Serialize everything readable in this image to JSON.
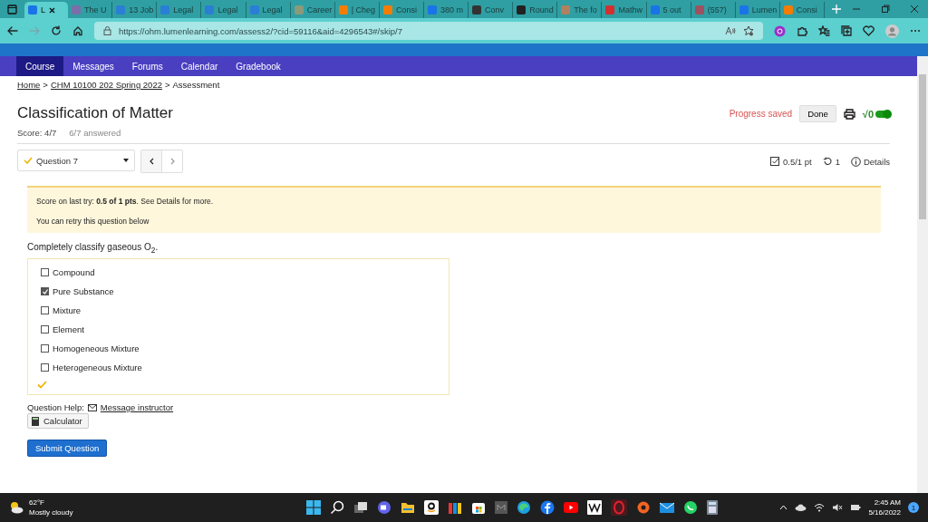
{
  "browser": {
    "tabs": [
      {
        "title": "L",
        "color": "#1a73e8",
        "selected": true
      },
      {
        "title": "The U",
        "color": "#7a6fa8",
        "selected": false
      },
      {
        "title": "13 Job",
        "color": "#2a7fd4",
        "selected": false
      },
      {
        "title": "Legal",
        "color": "#2a7fd4",
        "selected": false
      },
      {
        "title": "Legal",
        "color": "#2a7fd4",
        "selected": false
      },
      {
        "title": "Legal",
        "color": "#2a7fd4",
        "selected": false
      },
      {
        "title": "Career",
        "color": "#8a9a7a",
        "selected": false
      },
      {
        "title": "| Cheg",
        "color": "#f57c00",
        "selected": false
      },
      {
        "title": "Consi",
        "color": "#f57c00",
        "selected": false
      },
      {
        "title": "380 m",
        "color": "#1a73e8",
        "selected": false
      },
      {
        "title": "Conv",
        "color": "#333333",
        "selected": false
      },
      {
        "title": "Round",
        "color": "#222222",
        "selected": false
      },
      {
        "title": "The fo",
        "color": "#b08060",
        "selected": false
      },
      {
        "title": "Mathw",
        "color": "#d32f2f",
        "selected": false
      },
      {
        "title": "5 out",
        "color": "#1a73e8",
        "selected": false
      },
      {
        "title": "(557)",
        "color": "#a05060",
        "selected": false
      },
      {
        "title": "Lumen",
        "color": "#1a73e8",
        "selected": false
      },
      {
        "title": "Consi",
        "color": "#f57c00",
        "selected": false
      }
    ],
    "address": "https://ohm.lumenlearning.com/assess2/?cid=59116&aid=4296543#/skip/7"
  },
  "nav": [
    {
      "label": "Course",
      "selected": true
    },
    {
      "label": "Messages",
      "selected": false
    },
    {
      "label": "Forums",
      "selected": false
    },
    {
      "label": "Calendar",
      "selected": false
    },
    {
      "label": "Gradebook",
      "selected": false
    }
  ],
  "breadcrumb": {
    "separator": ">",
    "items": [
      {
        "label": "Home",
        "link": true
      },
      {
        "label": "CHM 10100 202 Spring 2022",
        "link": true
      },
      {
        "label": "Assessment",
        "link": false
      }
    ]
  },
  "assessment": {
    "title": "Classification of Matter",
    "score": "Score: 4/7",
    "answered": "6/7 answered",
    "progress": "Progress saved",
    "done": "Done",
    "math_toggle": {
      "label": "√0",
      "on": true
    },
    "question_select": "Question 7",
    "points": "0.5/1 pt",
    "retries": "1",
    "details": "Details"
  },
  "alert": {
    "lines": [
      "Score on last try: **0.5 of 1 pts**. See Details for more.",
      "You can retry this question below"
    ]
  },
  "question": {
    "prompt": "Completely classify gaseous O$_{2}$.",
    "choices": [
      {
        "label": "Compound",
        "checked": false
      },
      {
        "label": "Pure Substance",
        "checked": true
      },
      {
        "label": "Mixture",
        "checked": false
      },
      {
        "label": "Element",
        "checked": false
      },
      {
        "label": "Homogeneous Mixture",
        "checked": false
      },
      {
        "label": "Heterogeneous Mixture",
        "checked": false
      }
    ]
  },
  "help": {
    "label": "Question Help:",
    "message": "Message instructor",
    "calculator": "Calculator"
  },
  "submit": "Submit Question",
  "taskbar": {
    "temp": "62°F",
    "weather": "Mostly cloudy",
    "time": "2:45 AM",
    "date": "5/16/2022",
    "badge": "1"
  }
}
